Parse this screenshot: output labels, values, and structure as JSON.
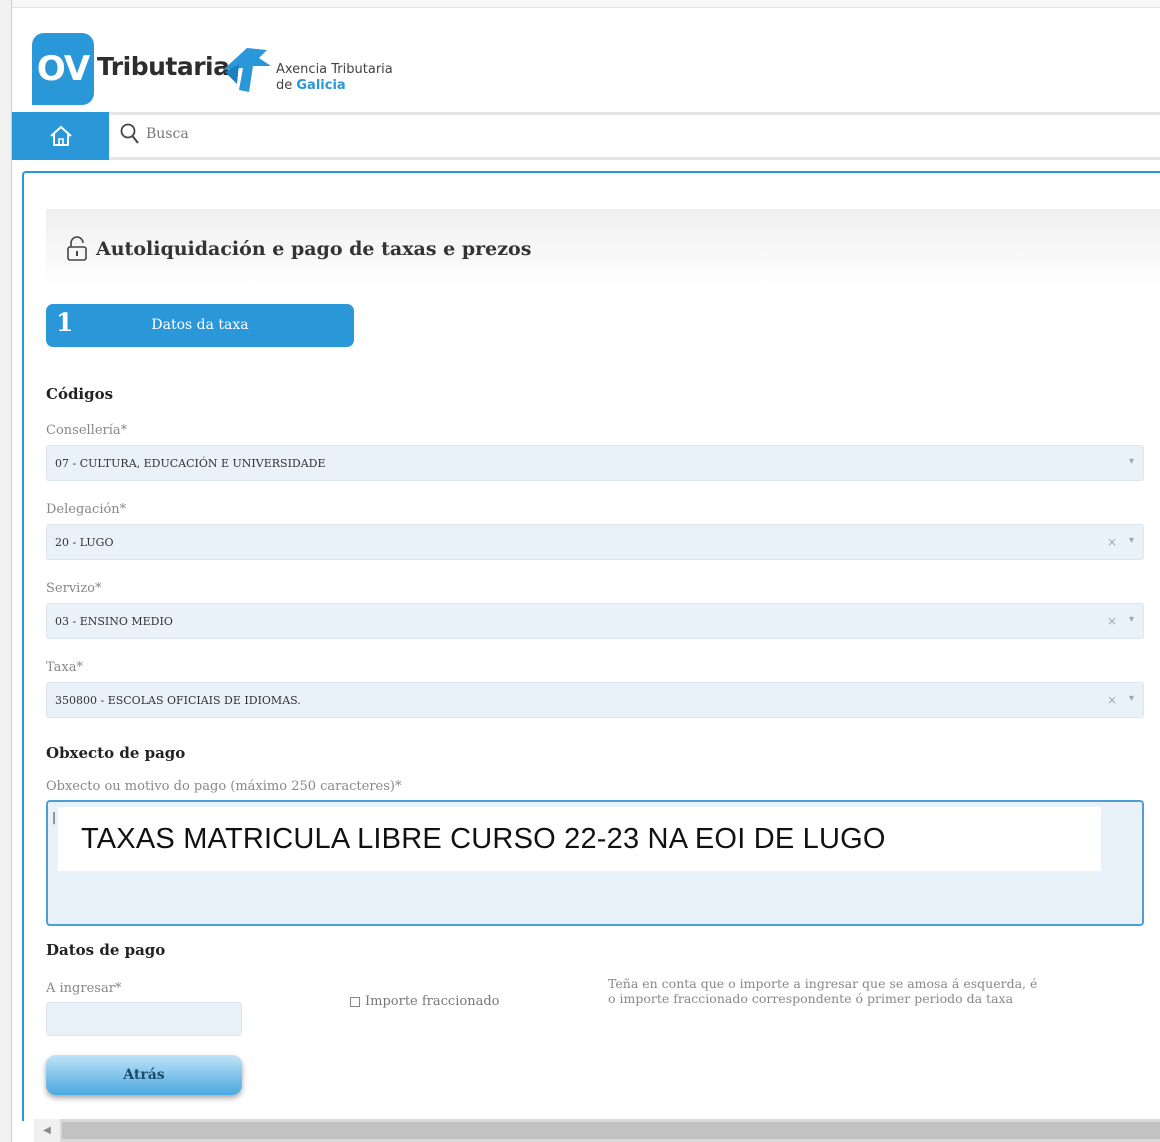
{
  "header": {
    "logo_ov": "OV",
    "logo_tributaria": "Tributaria",
    "agency_line1": "Axencia Tributaria",
    "agency_de": "de ",
    "agency_galicia": "Galicia"
  },
  "nav": {
    "home_icon": "home-icon",
    "search_placeholder": "Busca"
  },
  "page": {
    "title": "Autoliquidación e pago de taxas e prezos"
  },
  "step": {
    "number": "1",
    "label": "Datos da taxa"
  },
  "codes": {
    "title": "Códigos",
    "conselleria_label": "Consellería*",
    "conselleria_value": "07 - CULTURA, EDUCACIÓN E UNIVERSIDADE",
    "delegacion_label": "Delegación*",
    "delegacion_value": "20 - LUGO",
    "servizo_label": "Servizo*",
    "servizo_value": "03 - ENSINO MEDIO",
    "taxa_label": "Taxa*",
    "taxa_value": "350800 - ESCOLAS OFICIAIS DE IDIOMAS."
  },
  "object": {
    "title": "Obxecto de pago",
    "label": "Obxecto ou motivo do pago (máximo 250 caracteres)*",
    "value": "TAXAS MATRICULA LIBRE CURSO 22-23 NA EOI DE LUGO"
  },
  "payment": {
    "title": "Datos de pago",
    "amount_label": "A ingresar*",
    "amount_value": "",
    "fraction_label": "Importe fraccionado",
    "note": "Teña en conta que o importe a ingresar que se amosa á esquerda, é o importe fraccionado correspondente ó primer periodo da taxa"
  },
  "buttons": {
    "back": "Atrás"
  },
  "colors": {
    "brand_blue": "#2a97d9",
    "field_bg": "#e9f1f9"
  }
}
